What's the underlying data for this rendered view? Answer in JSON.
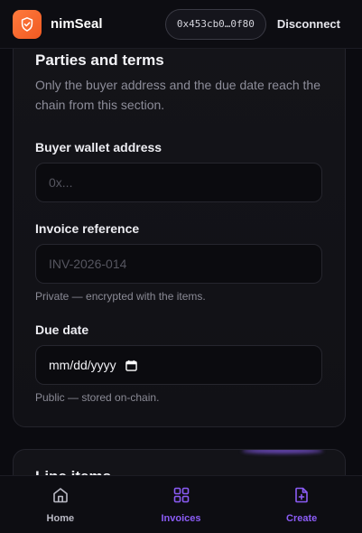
{
  "app": {
    "name": "nimSeal"
  },
  "header": {
    "wallet_address": "0x453cb0…0f80",
    "disconnect_label": "Disconnect"
  },
  "card": {
    "title": "Parties and terms",
    "subtitle": "Only the buyer address and the due date reach the chain from this section.",
    "fields": {
      "buyer": {
        "label": "Buyer wallet address",
        "placeholder": "0x..."
      },
      "invoice_ref": {
        "label": "Invoice reference",
        "placeholder": "INV-2026-014",
        "helper": "Private — encrypted with the items."
      },
      "due_date": {
        "label": "Due date",
        "value": "mm/dd/yyyy",
        "helper": "Public — stored on-chain."
      }
    }
  },
  "next_card": {
    "title": "Line items"
  },
  "bottom_nav": {
    "items": [
      {
        "label": "Home",
        "icon": "home-icon"
      },
      {
        "label": "Invoices",
        "icon": "grid-icon"
      },
      {
        "label": "Create",
        "icon": "document-plus-icon"
      }
    ]
  },
  "colors": {
    "accent": "#8b5cf6",
    "brand": "#f05a22",
    "background": "#0b0b10"
  }
}
